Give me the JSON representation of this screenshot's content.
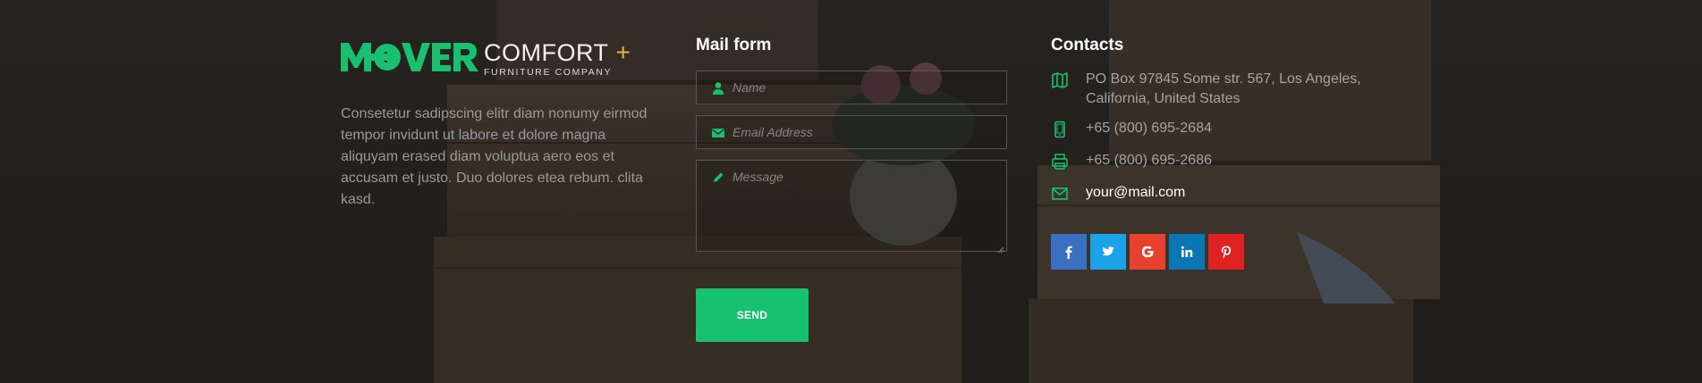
{
  "colors": {
    "accent": "#17c16f",
    "logo_plus": "#e4b13a",
    "facebook": "#3b6fc0",
    "twitter": "#1aa3e8",
    "google": "#e8412e",
    "linkedin": "#0b76b4",
    "pinterest": "#e02121"
  },
  "brand": {
    "logo_word": "MOVER",
    "logo_comfort": "COMFORT",
    "logo_plus": "+",
    "logo_sub": "FURNITURE COMPANY",
    "description": "Consetetur sadipscing elitr diam nonumy eirmod tempor invidunt ut labore et dolore magna aliquyam erased diam voluptua aero eos et accusam et justo. Duo dolores etea rebum. clita kasd."
  },
  "mail_form": {
    "title": "Mail form",
    "name_placeholder": "Name",
    "email_placeholder": "Email Address",
    "message_placeholder": "Message",
    "send_label": "SEND",
    "icons": [
      "user-icon",
      "envelope-icon",
      "pencil-icon"
    ]
  },
  "contacts": {
    "title": "Contacts",
    "address": "PO Box 97845 Some str. 567, Los Angeles, California, United States",
    "phone1": "+65 (800) 695-2684",
    "phone2": "+65 (800) 695-2686",
    "email": "your@mail.com",
    "icons": [
      "map-icon",
      "mobile-phone-icon",
      "printer-icon",
      "envelope-icon"
    ]
  },
  "socials": [
    {
      "name": "facebook",
      "glyph": "f"
    },
    {
      "name": "twitter",
      "glyph": ""
    },
    {
      "name": "google",
      "glyph": "G"
    },
    {
      "name": "linkedin",
      "glyph": "in"
    },
    {
      "name": "pinterest",
      "glyph": ""
    }
  ]
}
